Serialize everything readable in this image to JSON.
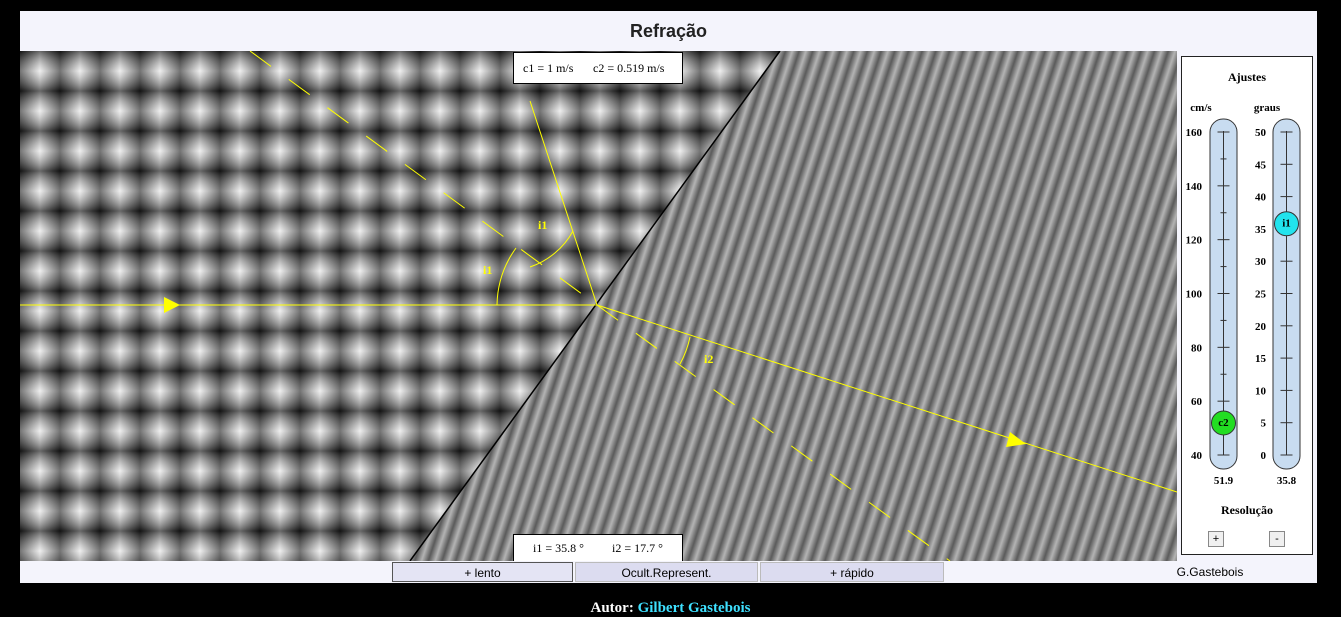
{
  "title": "Refração",
  "info": {
    "c1": "c1 = 1 m/s",
    "c2": "c2 = 0.519 m/s",
    "i1": "i1 = 35.8 °",
    "i2": "i2 = 17.7 °"
  },
  "diagram_labels": {
    "incident_angle": "i1",
    "normal_angle": "i1",
    "refracted_angle": "i2"
  },
  "panel": {
    "title": "Ajustes",
    "left_unit": "cm/s",
    "right_unit": "graus",
    "left_ticks": [
      "160",
      "140",
      "120",
      "100",
      "80",
      "60",
      "40"
    ],
    "right_ticks": [
      "50",
      "45",
      "40",
      "35",
      "30",
      "25",
      "20",
      "15",
      "10",
      "5",
      "0"
    ],
    "left_slider": {
      "label": "c2",
      "value": 51.9,
      "min": 40,
      "max": 160,
      "readout": "51.9",
      "color": "#22dd22"
    },
    "right_slider": {
      "label": "i1",
      "value": 35.8,
      "min": 0,
      "max": 50,
      "readout": "35.8",
      "color": "#22e4ee"
    },
    "resolution_label": "Resolução",
    "res_plus": "+",
    "res_minus": "-"
  },
  "buttons": {
    "slower": "+ lento",
    "hide": "Ocult.Represent.",
    "faster": "+ rápido"
  },
  "author_tag": "G.Gastebois",
  "credit": {
    "prefix": "Autor:",
    "name": "Gilbert Gastebois"
  },
  "colors": {
    "ray": "#ffff00",
    "track": "#c8dcf0",
    "accent": "#000000"
  }
}
